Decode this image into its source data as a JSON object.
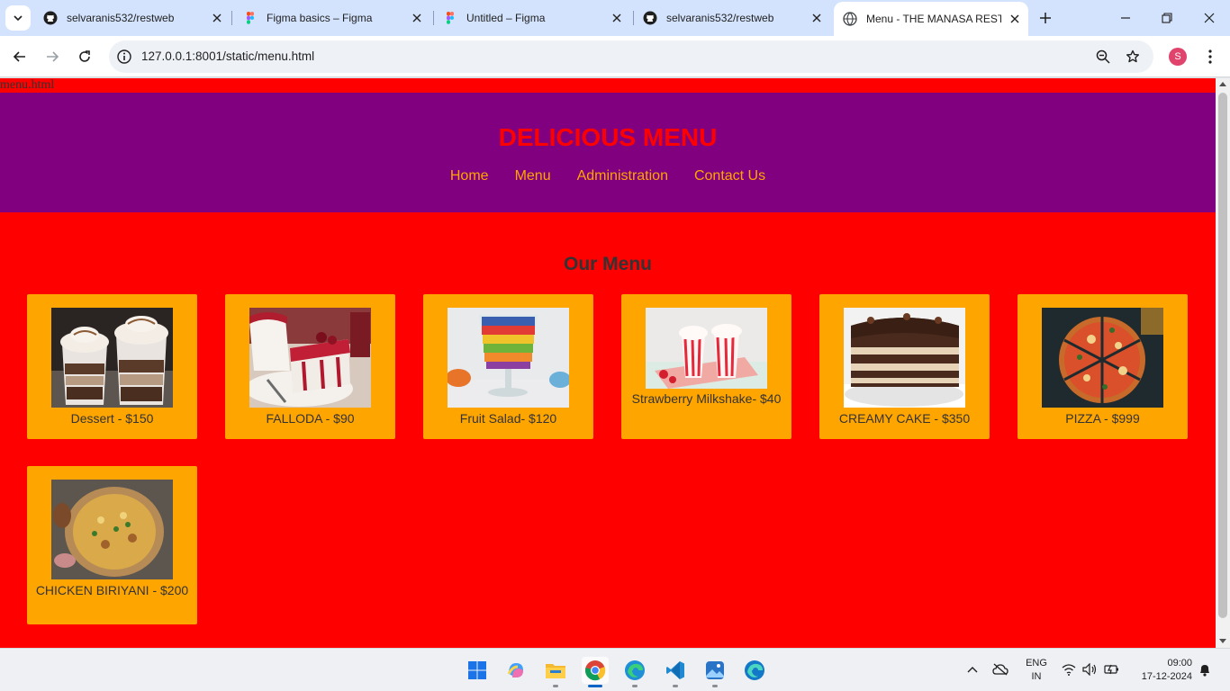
{
  "browser": {
    "tabs": [
      {
        "title": "selvaranis532/restweb",
        "icon": "github-icon"
      },
      {
        "title": "Figma basics – Figma",
        "icon": "figma-icon"
      },
      {
        "title": "Untitled – Figma",
        "icon": "figma-icon"
      },
      {
        "title": "selvaranis532/restweb",
        "icon": "github-icon"
      },
      {
        "title": "Menu - THE MANASA RESTA",
        "icon": "globe-icon",
        "active": true
      }
    ],
    "url": "127.0.0.1:8001/static/menu.html",
    "profile_initial": "S"
  },
  "page": {
    "file_label": "menu.html",
    "header": {
      "title": "DELICIOUS MENU",
      "nav": [
        "Home",
        "Menu",
        "Administration",
        "Contact Us"
      ]
    },
    "section_title": "Our Menu",
    "items": [
      {
        "label": "Dessert - $150"
      },
      {
        "label": "FALLODA - $90"
      },
      {
        "label": "Fruit Salad- $120"
      },
      {
        "label": "Strawberry Milkshake- $40"
      },
      {
        "label": "CREAMY CAKE - $350"
      },
      {
        "label": "PIZZA - $999"
      },
      {
        "label": "CHICKEN BIRIYANI - $200"
      }
    ]
  },
  "taskbar": {
    "apps": [
      "windows-start-icon",
      "copilot-icon",
      "file-explorer-icon",
      "chrome-icon",
      "edge-icon",
      "vscode-icon",
      "photos-icon",
      "edge-beta-icon"
    ],
    "lang_top": "ENG",
    "lang_bottom": "IN",
    "time": "09:00",
    "date": "17-12-2024"
  },
  "colors": {
    "page_bg": "#ff0000",
    "header_bg": "#800080",
    "header_title": "#ff0000",
    "nav_link": "#ffa500",
    "card_bg": "#ffa500",
    "text": "#333333"
  }
}
